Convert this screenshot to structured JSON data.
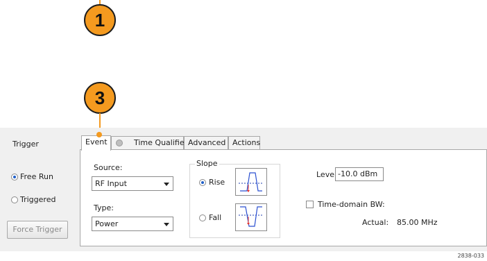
{
  "callouts": [
    "1",
    "3"
  ],
  "trigger": {
    "heading": "Trigger",
    "free_run_label": "Free Run",
    "triggered_label": "Triggered",
    "force_trigger_label": "Force Trigger",
    "mode_selected": "Free Run"
  },
  "tabs": [
    {
      "label": "Event"
    },
    {
      "label": "Time Qualified"
    },
    {
      "label": "Advanced"
    },
    {
      "label": "Actions"
    }
  ],
  "event": {
    "source_label": "Source:",
    "source_value": "RF Input",
    "type_label": "Type:",
    "type_value": "Power",
    "slope_label": "Slope",
    "rise_label": "Rise",
    "fall_label": "Fall",
    "slope_selected": "Rise",
    "level_label": "Level:",
    "level_value": "-10.0 dBm",
    "time_domain_bw_label": "Time-domain BW:",
    "time_domain_bw_checked": false,
    "actual_label": "Actual:",
    "actual_value": "85.00 MHz"
  },
  "figure_id": "2838-033",
  "colors": {
    "callout": "#f49a1f",
    "radio_dot": "#1f5fc8",
    "slope_marker": "#e8302a"
  }
}
